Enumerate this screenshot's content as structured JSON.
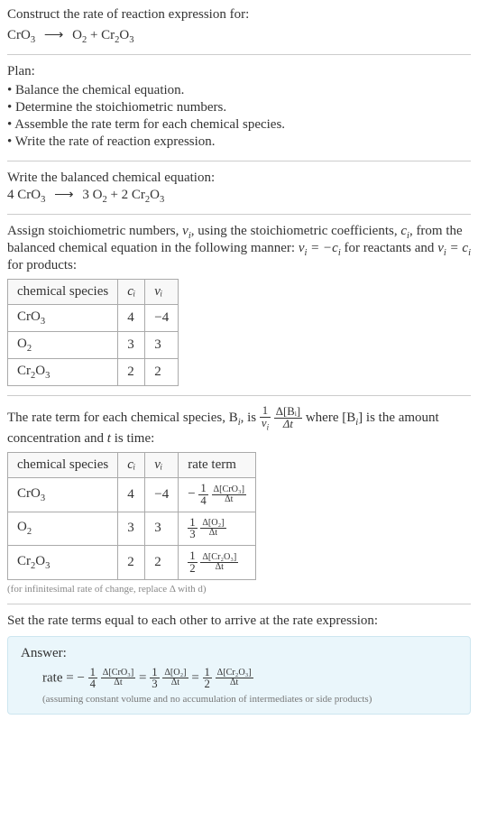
{
  "prompt": {
    "title": "Construct the rate of reaction expression for:",
    "equation_lhs": "CrO",
    "equation_lhs_sub": "3",
    "equation_rhs1": "O",
    "equation_rhs1_sub": "2",
    "equation_rhs2": "Cr",
    "equation_rhs2_sub1": "2",
    "equation_rhs2_mid": "O",
    "equation_rhs2_sub2": "3"
  },
  "plan": {
    "title": "Plan:",
    "items": [
      "Balance the chemical equation.",
      "Determine the stoichiometric numbers.",
      "Assemble the rate term for each chemical species.",
      "Write the rate of reaction expression."
    ]
  },
  "balanced": {
    "title": "Write the balanced chemical equation:",
    "c1": "4 CrO",
    "c1_sub": "3",
    "c2": "3 O",
    "c2_sub": "2",
    "c3": "2 Cr",
    "c3_sub1": "2",
    "c3_mid": "O",
    "c3_sub2": "3"
  },
  "stoich": {
    "intro_a": "Assign stoichiometric numbers, ",
    "nu_i": "ν",
    "nu_i_sub": "i",
    "intro_b": ", using the stoichiometric coefficients, ",
    "c_i": "c",
    "c_i_sub": "i",
    "intro_c": ", from the balanced chemical equation in the following manner: ",
    "rel1_a": "ν",
    "rel1_b": " = −c",
    "rel1_c": " for reactants and ",
    "rel2_a": "ν",
    "rel2_b": " = c",
    "rel2_c": " for products:",
    "headers": [
      "chemical species",
      "cᵢ",
      "νᵢ"
    ],
    "rows": [
      {
        "species_a": "CrO",
        "species_sub": "3",
        "c": "4",
        "nu": "−4"
      },
      {
        "species_a": "O",
        "species_sub": "2",
        "c": "3",
        "nu": "3"
      },
      {
        "species_a": "Cr",
        "species_sub1": "2",
        "species_mid": "O",
        "species_sub2": "3",
        "c": "2",
        "nu": "2"
      }
    ]
  },
  "rate_term": {
    "intro_a": "The rate term for each chemical species, B",
    "intro_sub": "i",
    "intro_b": ", is ",
    "frac1_num": "1",
    "frac1_den_a": "ν",
    "frac1_den_sub": "i",
    "frac2_num": "Δ[Bᵢ]",
    "frac2_den": "Δt",
    "intro_c": " where [B",
    "intro_c_sub": "i",
    "intro_d": "] is the amount concentration and ",
    "t": "t",
    "intro_e": " is time:",
    "headers": [
      "chemical species",
      "cᵢ",
      "νᵢ",
      "rate term"
    ],
    "rows": [
      {
        "species_a": "CrO",
        "species_sub": "3",
        "c": "4",
        "nu": "−4",
        "sign": "−",
        "f1n": "1",
        "f1d": "4",
        "f2n": "Δ[CrO₃]",
        "f2d": "Δt"
      },
      {
        "species_a": "O",
        "species_sub": "2",
        "c": "3",
        "nu": "3",
        "sign": "",
        "f1n": "1",
        "f1d": "3",
        "f2n": "Δ[O₂]",
        "f2d": "Δt"
      },
      {
        "species_a": "Cr",
        "species_sub1": "2",
        "species_mid": "O",
        "species_sub2": "3",
        "c": "2",
        "nu": "2",
        "sign": "",
        "f1n": "1",
        "f1d": "2",
        "f2n": "Δ[Cr₂O₃]",
        "f2d": "Δt"
      }
    ],
    "note": "(for infinitesimal rate of change, replace Δ with d)"
  },
  "final": {
    "title": "Set the rate terms equal to each other to arrive at the rate expression:",
    "answer_label": "Answer:",
    "rate_label": "rate = ",
    "t1_sign": "−",
    "t1_f1n": "1",
    "t1_f1d": "4",
    "t1_f2n": "Δ[CrO₃]",
    "t1_f2d": "Δt",
    "eq1": " = ",
    "t2_f1n": "1",
    "t2_f1d": "3",
    "t2_f2n": "Δ[O₂]",
    "t2_f2d": "Δt",
    "eq2": " = ",
    "t3_f1n": "1",
    "t3_f1d": "2",
    "t3_f2n": "Δ[Cr₂O₃]",
    "t3_f2d": "Δt",
    "note": "(assuming constant volume and no accumulation of intermediates or side products)"
  }
}
